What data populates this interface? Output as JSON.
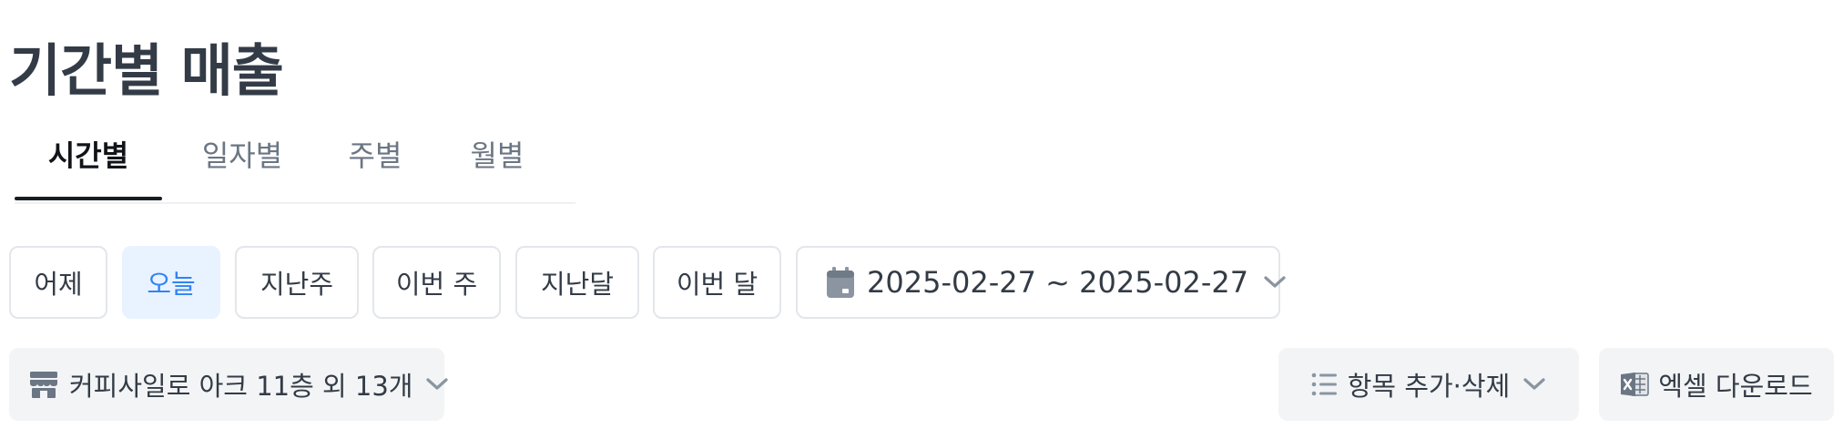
{
  "page": {
    "title": "기간별 매출"
  },
  "tabs": [
    {
      "label": "시간별",
      "active": true
    },
    {
      "label": "일자별",
      "active": false
    },
    {
      "label": "주별",
      "active": false
    },
    {
      "label": "월별",
      "active": false
    }
  ],
  "quick_ranges": [
    {
      "label": "어제",
      "selected": false
    },
    {
      "label": "오늘",
      "selected": true
    },
    {
      "label": "지난주",
      "selected": false
    },
    {
      "label": "이번 주",
      "selected": false
    },
    {
      "label": "지난달",
      "selected": false
    },
    {
      "label": "이번 달",
      "selected": false
    }
  ],
  "date_range": {
    "value": "2025-02-27 ~ 2025-02-27",
    "icon": "calendar-icon"
  },
  "store_selector": {
    "label": "커피사일로 아크 11층 외 13개",
    "icon": "store-icon"
  },
  "column_editor": {
    "label": "항목 추가·삭제",
    "icon": "list-icon"
  },
  "excel_download": {
    "label": "엑셀 다운로드",
    "icon": "excel-icon"
  },
  "colors": {
    "text_primary": "#333b46",
    "accent": "#3182f6",
    "accent_bg": "#e8f3ff",
    "secondary_bg": "#f2f4f6",
    "border": "#e3e6ea"
  }
}
